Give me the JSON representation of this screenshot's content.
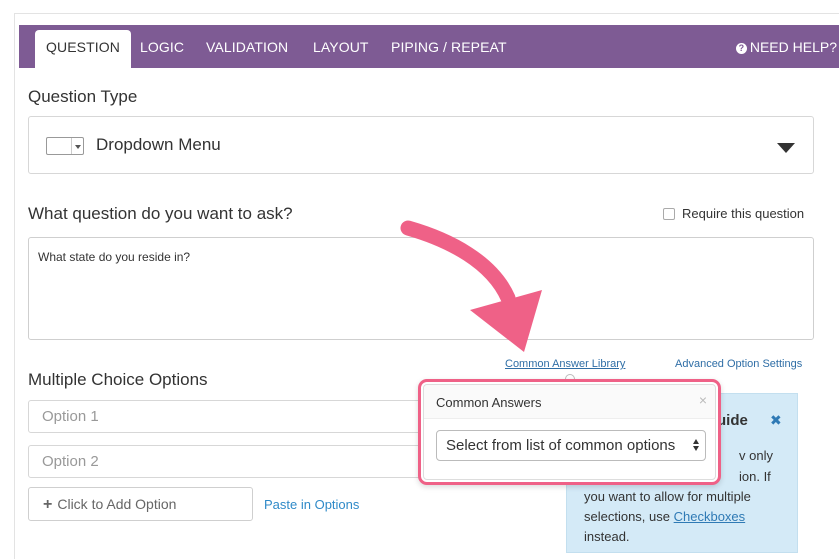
{
  "tabs": [
    {
      "label": "QUESTION",
      "active": true
    },
    {
      "label": "LOGIC",
      "active": false
    },
    {
      "label": "VALIDATION",
      "active": false
    },
    {
      "label": "LAYOUT",
      "active": false
    },
    {
      "label": "PIPING / REPEAT",
      "active": false
    }
  ],
  "help": {
    "label": "NEED HELP?",
    "icon": "question-circle-icon"
  },
  "question_type": {
    "heading": "Question Type",
    "selected": "Dropdown Menu",
    "icon": "dropdown-menu-icon"
  },
  "question": {
    "heading": "What question do you want to ask?",
    "require_label": "Require this question",
    "require_checked": false,
    "text": "What state do you reside in?"
  },
  "options_section": {
    "common_answer_link": "Common Answer Library",
    "advanced_link": "Advanced Option Settings",
    "heading": "Multiple Choice Options",
    "option_placeholders": [
      "Option 1",
      "Option 2"
    ],
    "add_option": "Click to Add Option",
    "paste_options": "Paste in Options"
  },
  "common_answers_popover": {
    "title": "Common Answers",
    "close": "×",
    "select_value": "Select from list of common options"
  },
  "guide": {
    "title_fragment": "uide",
    "close": "✖",
    "lines": [
      "v only",
      "ion. If",
      "you want to allow for multiple",
      "selections, use",
      "instead."
    ],
    "checkboxes_link": "Checkboxes"
  },
  "colors": {
    "tabbar": "#7e5b94",
    "highlight": "#ef6187",
    "link": "#2f6ea6",
    "guide_bg": "#d4eaf7"
  }
}
